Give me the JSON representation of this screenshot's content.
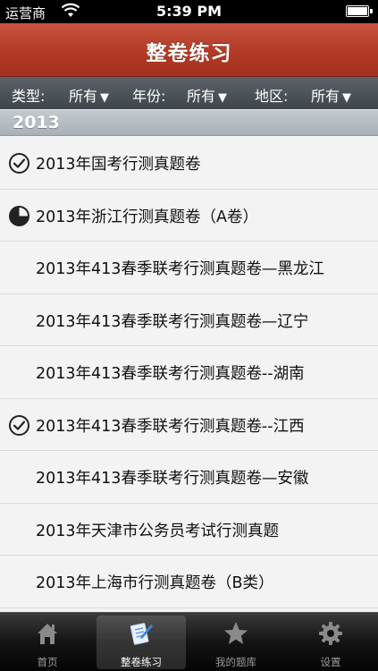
{
  "status_bar": {
    "carrier": "运营商",
    "time": "5:39 PM",
    "battery_level": 1.0
  },
  "nav": {
    "title": "整卷练习"
  },
  "filters": [
    {
      "label": "类型:",
      "value": "所有"
    },
    {
      "label": "年份:",
      "value": "所有"
    },
    {
      "label": "地区:",
      "value": "所有"
    }
  ],
  "filter_arrow": "▼",
  "section": {
    "title": "2013"
  },
  "papers": [
    {
      "title": "2013年国考行测真题卷",
      "status": "completed",
      "icon": "check-circle-icon"
    },
    {
      "title": "2013年浙江行测真题卷（A卷）",
      "status": "in-progress",
      "icon": "pie-progress-icon"
    },
    {
      "title": "2013年413春季联考行测真题卷—黑龙江",
      "status": "none"
    },
    {
      "title": "2013年413春季联考行测真题卷—辽宁",
      "status": "none"
    },
    {
      "title": "2013年413春季联考行测真题卷--湖南",
      "status": "none"
    },
    {
      "title": "2013年413春季联考行测真题卷--江西",
      "status": "completed",
      "icon": "check-circle-icon"
    },
    {
      "title": "2013年413春季联考行测真题卷—安徽",
      "status": "none"
    },
    {
      "title": "2013年天津市公务员考试行测真题",
      "status": "none"
    },
    {
      "title": "2013年上海市行测真题卷（B类）",
      "status": "none"
    }
  ],
  "tabs": [
    {
      "label": "首页",
      "icon": "home-icon",
      "selected": false
    },
    {
      "label": "整卷练习",
      "icon": "paper-pen-icon",
      "selected": true
    },
    {
      "label": "我的题库",
      "icon": "star-icon",
      "selected": false
    },
    {
      "label": "设置",
      "icon": "gear-icon",
      "selected": false
    }
  ],
  "colors": {
    "nav_red": "#b23a26",
    "filter_bar": "#4a5056",
    "section_header": "#b4bbc2",
    "tab_bar": "#141414"
  }
}
